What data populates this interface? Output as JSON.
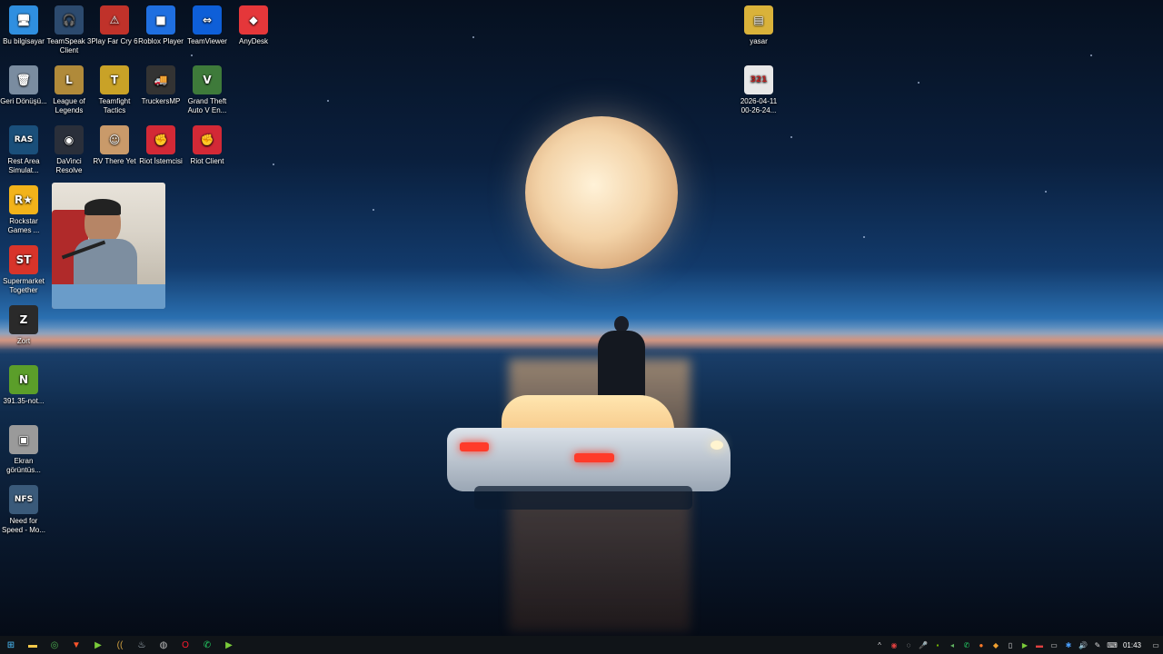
{
  "desktop": {
    "left_icons": [
      {
        "label": "Bu bilgisayar",
        "icon": "computer-icon",
        "color": "#2f8fe0",
        "glyph": "🖥"
      },
      {
        "label": "TeamSpeak 3 Client",
        "icon": "teamspeak-icon",
        "color": "#2c4a6e",
        "glyph": "🎧"
      },
      {
        "label": "Play Far Cry 6",
        "icon": "farcry-icon",
        "color": "#c0322a",
        "glyph": "⚠"
      },
      {
        "label": "Roblox Player",
        "icon": "roblox-icon",
        "color": "#1f6fe0",
        "glyph": "■"
      },
      {
        "label": "TeamViewer",
        "icon": "teamviewer-icon",
        "color": "#0e5fd8",
        "glyph": "⇔"
      },
      {
        "label": "AnyDesk",
        "icon": "anydesk-icon",
        "color": "#e5373a",
        "glyph": "◆"
      },
      {
        "label": "Geri Dönüşü...",
        "icon": "recycle-bin-icon",
        "color": "#7a8ca0",
        "glyph": "🗑"
      },
      {
        "label": "League of Legends",
        "icon": "league-icon",
        "color": "#b08a3a",
        "glyph": "L"
      },
      {
        "label": "Teamfight Tactics",
        "icon": "tft-icon",
        "color": "#c9a227",
        "glyph": "T"
      },
      {
        "label": "TruckersMP",
        "icon": "truckersmp-icon",
        "color": "#333333",
        "glyph": "🚚"
      },
      {
        "label": "Grand Theft Auto V En...",
        "icon": "gta-icon",
        "color": "#3e7a3a",
        "glyph": "V"
      },
      {
        "label": "Rest Area Simulat...",
        "icon": "rest-area-icon",
        "color": "#1a4f7a",
        "glyph": "RAS"
      },
      {
        "label": "DaVinci Resolve",
        "icon": "davinci-icon",
        "color": "#2a2f3a",
        "glyph": "◉"
      },
      {
        "label": "RV There Yet",
        "icon": "rv-icon",
        "color": "#c99a6a",
        "glyph": "☺"
      },
      {
        "label": "Riot İstemcisi",
        "icon": "riot-icon",
        "color": "#d32936",
        "glyph": "✊"
      },
      {
        "label": "Riot Client",
        "icon": "riot-client-icon",
        "color": "#d32936",
        "glyph": "✊"
      },
      {
        "label": "Rockstar Games ...",
        "icon": "rockstar-icon",
        "color": "#f2b31a",
        "glyph": "R★"
      },
      {
        "label": "Supermarket Together",
        "icon": "supermarket-icon",
        "color": "#d8342a",
        "glyph": "ST"
      },
      {
        "label": "Zort",
        "icon": "zort-icon",
        "color": "#2a2a2a",
        "glyph": "Z"
      },
      {
        "label": "391.35-not...",
        "icon": "nvidia-icon",
        "color": "#5b9e2a",
        "glyph": "N"
      },
      {
        "label": "Ekran görüntüs...",
        "icon": "screenshot-icon",
        "color": "#9a9a9a",
        "glyph": "▣"
      },
      {
        "label": "Need for Speed - Mo...",
        "icon": "nfs-icon",
        "color": "#3a5a7a",
        "glyph": "NFS"
      }
    ],
    "right_icons": [
      {
        "label": "yasar",
        "icon": "archive-icon",
        "color": "#d9b23a",
        "glyph": "▤"
      },
      {
        "label": "2026-04-11 00-26-24...",
        "icon": "video-file-icon",
        "color": "#e8e8e8",
        "glyph": "321"
      }
    ]
  },
  "taskbar": {
    "apps": [
      {
        "name": "start-button",
        "glyph": "⊞",
        "color": "#4cc2ff"
      },
      {
        "name": "file-explorer-icon",
        "glyph": "▬",
        "color": "#f3c84a"
      },
      {
        "name": "chrome-icon",
        "glyph": "◎",
        "color": "#4caf50"
      },
      {
        "name": "brave-icon",
        "glyph": "▼",
        "color": "#fb542b"
      },
      {
        "name": "launcher-icon",
        "glyph": "▶",
        "color": "#7acb3a"
      },
      {
        "name": "audio-app-icon",
        "glyph": "((",
        "color": "#d0a040"
      },
      {
        "name": "steam-icon",
        "glyph": "♨",
        "color": "#c6d4df"
      },
      {
        "name": "obs-icon",
        "glyph": "◍",
        "color": "#bbbbbb"
      },
      {
        "name": "opera-icon",
        "glyph": "O",
        "color": "#ff1b2d"
      },
      {
        "name": "whatsapp-icon",
        "glyph": "✆",
        "color": "#25d366"
      },
      {
        "name": "media-player-icon",
        "glyph": "▶",
        "color": "#7acb3a"
      }
    ],
    "tray": [
      {
        "name": "show-hidden-icons",
        "glyph": "^",
        "color": "#dddddd"
      },
      {
        "name": "tray-app-1-icon",
        "glyph": "◉",
        "color": "#e04040"
      },
      {
        "name": "tray-app-2-icon",
        "glyph": "◌",
        "color": "#dddddd"
      },
      {
        "name": "microphone-icon",
        "glyph": "🎤",
        "color": "#dddddd"
      },
      {
        "name": "nvidia-tray-icon",
        "glyph": "▪",
        "color": "#76b900"
      },
      {
        "name": "tray-app-3-icon",
        "glyph": "◂",
        "color": "#60b060"
      },
      {
        "name": "whatsapp-tray-icon",
        "glyph": "✆",
        "color": "#25d366"
      },
      {
        "name": "tray-app-4-icon",
        "glyph": "●",
        "color": "#ff7a2a"
      },
      {
        "name": "tray-app-5-icon",
        "glyph": "◆",
        "color": "#f0a030"
      },
      {
        "name": "battery-icon",
        "glyph": "▯",
        "color": "#dddddd"
      },
      {
        "name": "tray-app-6-icon",
        "glyph": "▶",
        "color": "#7acb3a"
      },
      {
        "name": "tray-app-7-icon",
        "glyph": "▬",
        "color": "#e04040"
      },
      {
        "name": "network-icon",
        "glyph": "▭",
        "color": "#dddddd"
      },
      {
        "name": "bluetooth-icon",
        "glyph": "✱",
        "color": "#4aa0ff"
      },
      {
        "name": "volume-icon",
        "glyph": "🔊",
        "color": "#dddddd"
      },
      {
        "name": "pen-icon",
        "glyph": "✎",
        "color": "#dddddd"
      },
      {
        "name": "keyboard-icon",
        "glyph": "⌨",
        "color": "#dddddd"
      }
    ],
    "clock": "01:43"
  }
}
